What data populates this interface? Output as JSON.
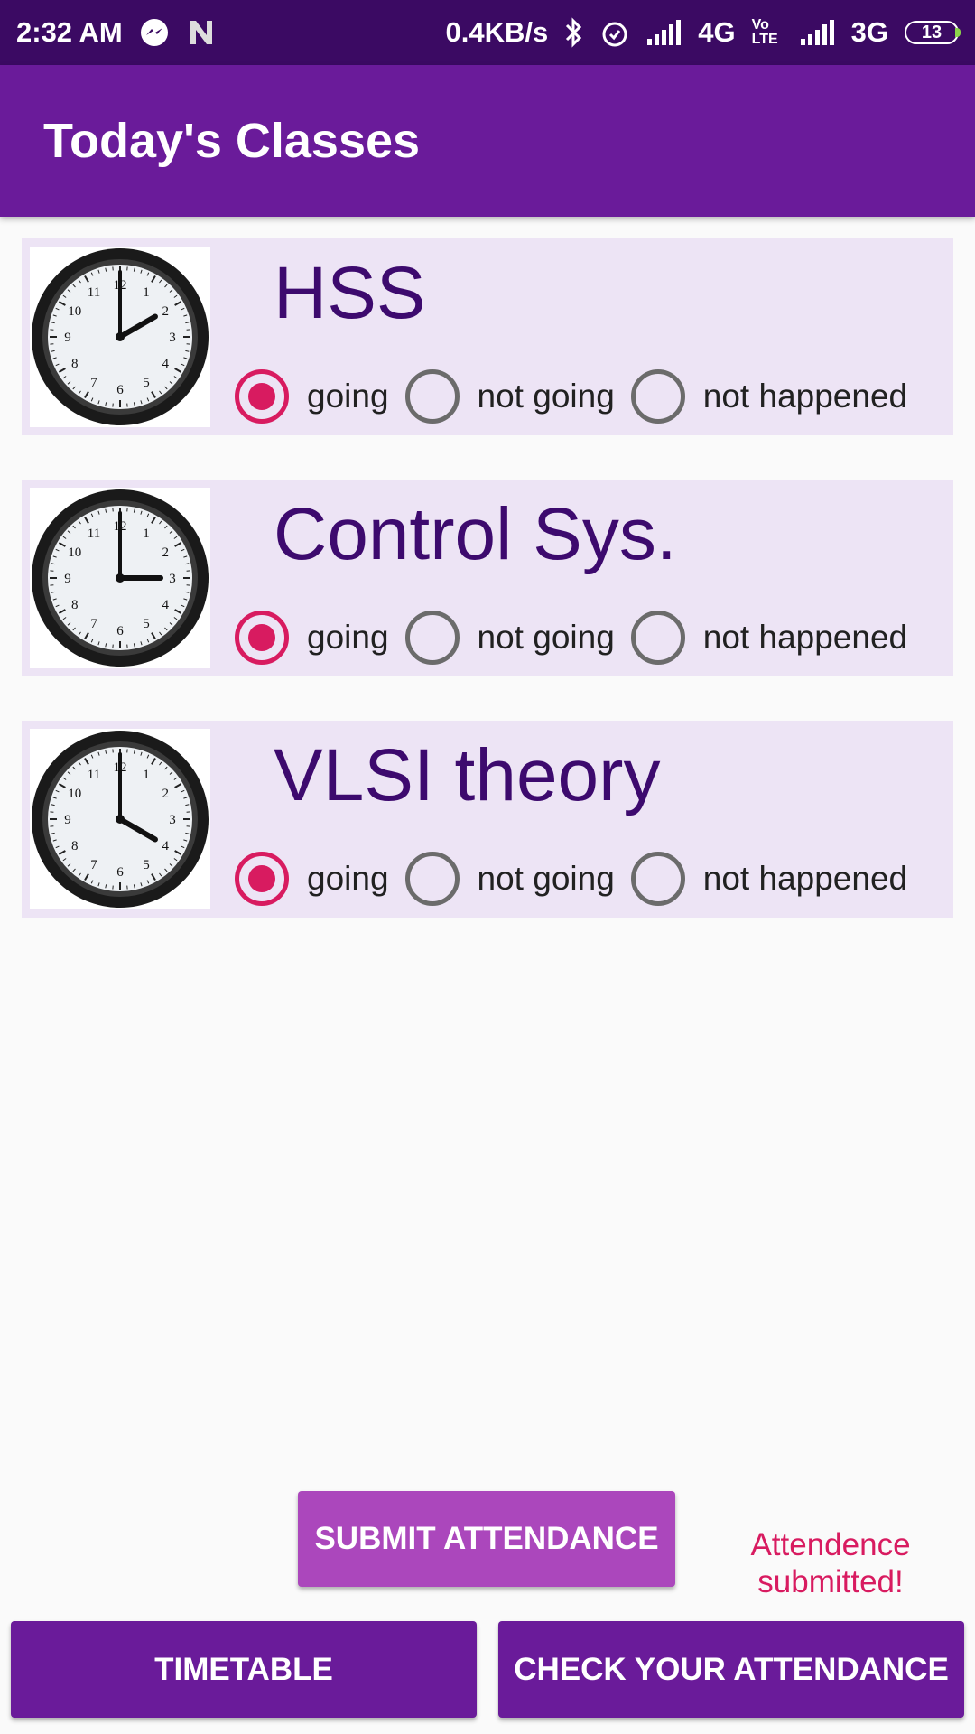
{
  "status_bar": {
    "time": "2:32 AM",
    "speed": "0.4KB/s",
    "network1": "4G",
    "volte": "Vo LTE",
    "network2": "3G",
    "battery": "13",
    "icons": [
      "messenger-icon",
      "n-app-icon",
      "bluetooth-icon",
      "alarm-icon",
      "signal-icon",
      "battery-icon"
    ]
  },
  "app_bar": {
    "title": "Today's Classes"
  },
  "classes": [
    {
      "name": "HSS",
      "clock_time": "2:00",
      "selected": "going",
      "options": {
        "going": "going",
        "not_going": "not going",
        "not_happened": "not happened"
      }
    },
    {
      "name": "Control Sys.",
      "clock_time": "3:00",
      "selected": "going",
      "options": {
        "going": "going",
        "not_going": "not going",
        "not_happened": "not happened"
      }
    },
    {
      "name": "VLSI theory",
      "clock_time": "4:00",
      "selected": "going",
      "options": {
        "going": "going",
        "not_going": "not going",
        "not_happened": "not happened"
      }
    }
  ],
  "actions": {
    "submit_label": "SUBMIT ATTENDANCE",
    "status_message": "Attendence submitted!",
    "timetable_label": "TIMETABLE",
    "check_label": "CHECK YOUR ATTENDANCE"
  },
  "colors": {
    "status_bar": "#3b0a63",
    "app_bar": "#6a1b9a",
    "card_bg": "#ede4f5",
    "class_title": "#3d0a6e",
    "accent": "#d81b60",
    "submit_button": "#ab47bc"
  }
}
